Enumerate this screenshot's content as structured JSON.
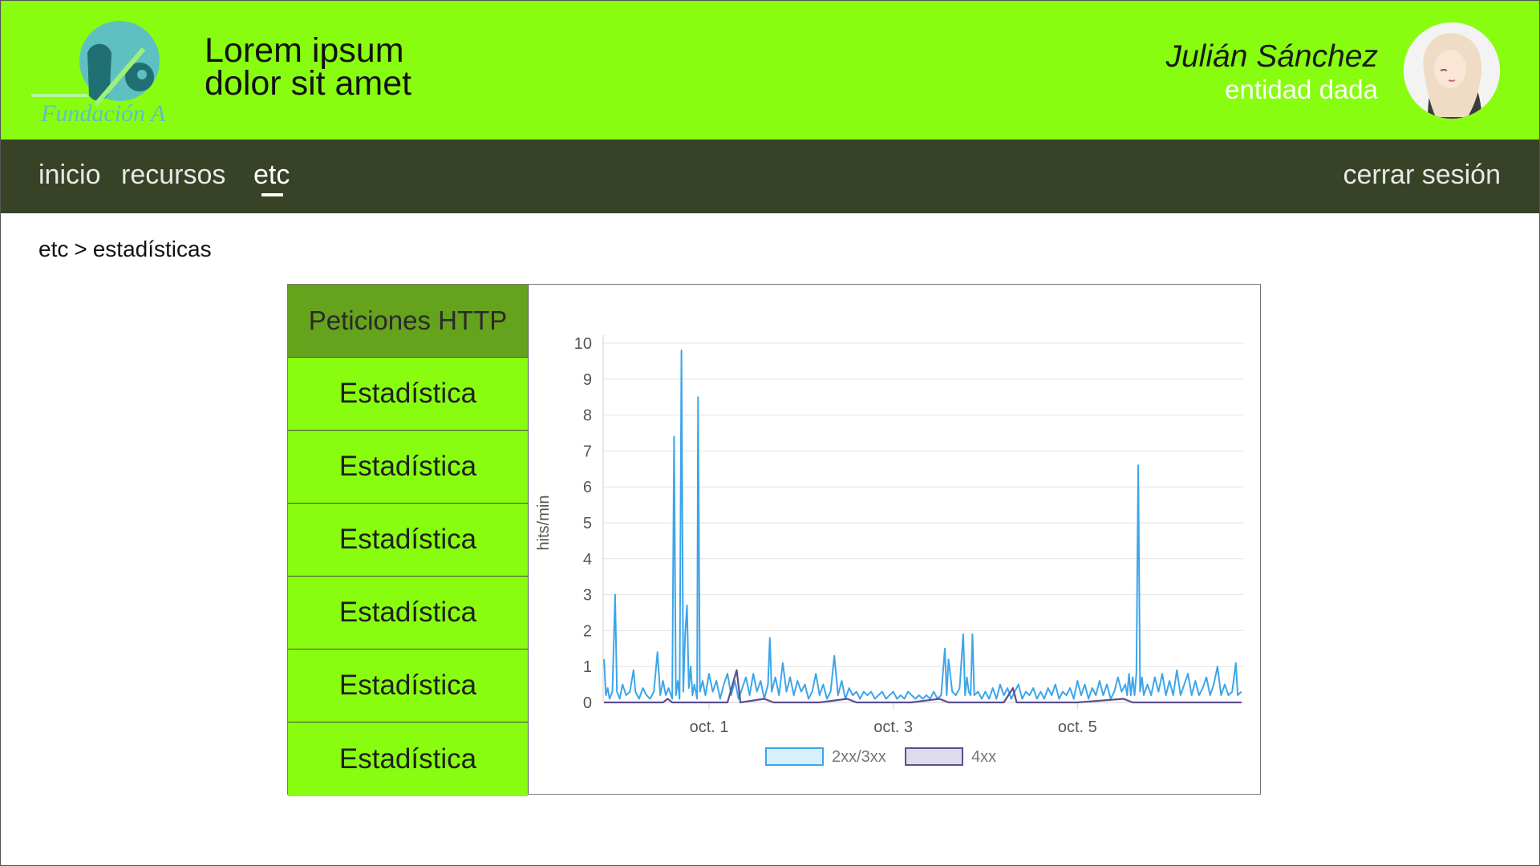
{
  "header": {
    "logo_text": "Fundación A",
    "title_line1": "Lorem ipsum",
    "title_line2": "dolor sit amet",
    "user_name": "Julián Sánchez",
    "user_entity": "entidad dada"
  },
  "nav": {
    "items": [
      {
        "label": "inicio"
      },
      {
        "label": "recursos"
      },
      {
        "label": "etc"
      }
    ],
    "active": "etc",
    "logout": "cerrar sesión"
  },
  "breadcrumb": {
    "parent": "etc",
    "separator": ">",
    "current": "estadísticas"
  },
  "stats_menu": {
    "header": "Peticiones HTTP",
    "items": [
      "Estadística",
      "Estadística",
      "Estadística",
      "Estadística",
      "Estadística",
      "Estadística"
    ]
  },
  "colors": {
    "header_bg": "#88fd10",
    "nav_bg": "#374226",
    "menu_head_bg": "#65a31c",
    "menu_item_bg": "#88fd10",
    "series_2xx": "#3da5ea",
    "series_4xx": "#5b4f8f"
  },
  "chart_data": {
    "type": "line",
    "ylabel": "hits/min",
    "ylim": [
      0,
      10
    ],
    "yticks": [
      "0",
      "1",
      "2",
      "3",
      "4",
      "5",
      "6",
      "7",
      "8",
      "9",
      "10"
    ],
    "xticks": [
      {
        "label": "oct. 1",
        "x": 1.0
      },
      {
        "label": "oct. 3",
        "x": 3.0
      },
      {
        "label": "oct. 5",
        "x": 5.0
      }
    ],
    "xlim": [
      -0.15,
      6.8
    ],
    "grid": true,
    "legend_position": "bottom",
    "series": [
      {
        "name": "2xx/3xx",
        "points": [
          [
            -0.14,
            1.2
          ],
          [
            -0.12,
            0.2
          ],
          [
            -0.1,
            0.4
          ],
          [
            -0.08,
            0.1
          ],
          [
            -0.05,
            0.3
          ],
          [
            -0.02,
            3.0
          ],
          [
            0.0,
            0.3
          ],
          [
            0.03,
            0.1
          ],
          [
            0.06,
            0.5
          ],
          [
            0.1,
            0.2
          ],
          [
            0.14,
            0.3
          ],
          [
            0.18,
            0.9
          ],
          [
            0.2,
            0.3
          ],
          [
            0.24,
            0.1
          ],
          [
            0.28,
            0.4
          ],
          [
            0.32,
            0.2
          ],
          [
            0.36,
            0.1
          ],
          [
            0.4,
            0.3
          ],
          [
            0.44,
            1.4
          ],
          [
            0.47,
            0.2
          ],
          [
            0.5,
            0.6
          ],
          [
            0.53,
            0.2
          ],
          [
            0.56,
            0.4
          ],
          [
            0.6,
            0.1
          ],
          [
            0.62,
            7.4
          ],
          [
            0.64,
            0.2
          ],
          [
            0.66,
            0.6
          ],
          [
            0.68,
            0.1
          ],
          [
            0.7,
            9.8
          ],
          [
            0.72,
            0.3
          ],
          [
            0.74,
            1.9
          ],
          [
            0.76,
            2.7
          ],
          [
            0.78,
            0.4
          ],
          [
            0.8,
            1.0
          ],
          [
            0.82,
            0.2
          ],
          [
            0.84,
            0.5
          ],
          [
            0.87,
            0.1
          ],
          [
            0.88,
            8.5
          ],
          [
            0.9,
            0.3
          ],
          [
            0.93,
            0.6
          ],
          [
            0.96,
            0.2
          ],
          [
            1.0,
            0.8
          ],
          [
            1.04,
            0.3
          ],
          [
            1.08,
            0.6
          ],
          [
            1.12,
            0.1
          ],
          [
            1.16,
            0.5
          ],
          [
            1.2,
            0.8
          ],
          [
            1.24,
            0.2
          ],
          [
            1.28,
            0.6
          ],
          [
            1.32,
            0.1
          ],
          [
            1.36,
            0.4
          ],
          [
            1.4,
            0.7
          ],
          [
            1.44,
            0.2
          ],
          [
            1.48,
            0.8
          ],
          [
            1.52,
            0.3
          ],
          [
            1.56,
            0.6
          ],
          [
            1.6,
            0.1
          ],
          [
            1.64,
            0.5
          ],
          [
            1.66,
            1.8
          ],
          [
            1.68,
            0.3
          ],
          [
            1.72,
            0.7
          ],
          [
            1.76,
            0.2
          ],
          [
            1.8,
            1.1
          ],
          [
            1.84,
            0.3
          ],
          [
            1.88,
            0.7
          ],
          [
            1.92,
            0.2
          ],
          [
            1.96,
            0.6
          ],
          [
            2.0,
            0.3
          ],
          [
            2.04,
            0.5
          ],
          [
            2.08,
            0.1
          ],
          [
            2.12,
            0.3
          ],
          [
            2.16,
            0.8
          ],
          [
            2.2,
            0.2
          ],
          [
            2.24,
            0.5
          ],
          [
            2.28,
            0.1
          ],
          [
            2.32,
            0.3
          ],
          [
            2.36,
            1.3
          ],
          [
            2.4,
            0.2
          ],
          [
            2.44,
            0.6
          ],
          [
            2.48,
            0.1
          ],
          [
            2.52,
            0.4
          ],
          [
            2.56,
            0.2
          ],
          [
            2.6,
            0.3
          ],
          [
            2.64,
            0.1
          ],
          [
            2.68,
            0.3
          ],
          [
            2.72,
            0.2
          ],
          [
            2.76,
            0.3
          ],
          [
            2.8,
            0.1
          ],
          [
            2.84,
            0.2
          ],
          [
            2.88,
            0.3
          ],
          [
            2.92,
            0.1
          ],
          [
            2.96,
            0.2
          ],
          [
            3.0,
            0.3
          ],
          [
            3.04,
            0.1
          ],
          [
            3.08,
            0.2
          ],
          [
            3.12,
            0.1
          ],
          [
            3.16,
            0.3
          ],
          [
            3.2,
            0.2
          ],
          [
            3.24,
            0.1
          ],
          [
            3.28,
            0.2
          ],
          [
            3.32,
            0.1
          ],
          [
            3.36,
            0.2
          ],
          [
            3.4,
            0.1
          ],
          [
            3.44,
            0.3
          ],
          [
            3.48,
            0.1
          ],
          [
            3.52,
            0.2
          ],
          [
            3.56,
            1.5
          ],
          [
            3.58,
            0.2
          ],
          [
            3.6,
            1.2
          ],
          [
            3.64,
            0.3
          ],
          [
            3.68,
            0.2
          ],
          [
            3.72,
            0.4
          ],
          [
            3.76,
            1.9
          ],
          [
            3.78,
            0.2
          ],
          [
            3.8,
            0.7
          ],
          [
            3.82,
            0.3
          ],
          [
            3.84,
            0.2
          ],
          [
            3.86,
            1.9
          ],
          [
            3.88,
            0.2
          ],
          [
            3.92,
            0.3
          ],
          [
            3.96,
            0.1
          ],
          [
            4.0,
            0.3
          ],
          [
            4.04,
            0.1
          ],
          [
            4.08,
            0.4
          ],
          [
            4.12,
            0.1
          ],
          [
            4.16,
            0.5
          ],
          [
            4.2,
            0.2
          ],
          [
            4.24,
            0.4
          ],
          [
            4.28,
            0.1
          ],
          [
            4.32,
            0.3
          ],
          [
            4.36,
            0.5
          ],
          [
            4.4,
            0.1
          ],
          [
            4.44,
            0.3
          ],
          [
            4.48,
            0.2
          ],
          [
            4.52,
            0.4
          ],
          [
            4.56,
            0.1
          ],
          [
            4.6,
            0.3
          ],
          [
            4.64,
            0.1
          ],
          [
            4.68,
            0.4
          ],
          [
            4.72,
            0.2
          ],
          [
            4.76,
            0.5
          ],
          [
            4.8,
            0.1
          ],
          [
            4.84,
            0.3
          ],
          [
            4.88,
            0.2
          ],
          [
            4.92,
            0.4
          ],
          [
            4.96,
            0.1
          ],
          [
            5.0,
            0.6
          ],
          [
            5.04,
            0.2
          ],
          [
            5.08,
            0.5
          ],
          [
            5.12,
            0.1
          ],
          [
            5.16,
            0.4
          ],
          [
            5.2,
            0.2
          ],
          [
            5.24,
            0.6
          ],
          [
            5.28,
            0.2
          ],
          [
            5.32,
            0.5
          ],
          [
            5.36,
            0.1
          ],
          [
            5.4,
            0.3
          ],
          [
            5.44,
            0.7
          ],
          [
            5.48,
            0.3
          ],
          [
            5.52,
            0.5
          ],
          [
            5.54,
            0.2
          ],
          [
            5.56,
            0.8
          ],
          [
            5.58,
            0.2
          ],
          [
            5.6,
            0.7
          ],
          [
            5.62,
            0.2
          ],
          [
            5.64,
            0.8
          ],
          [
            5.66,
            6.6
          ],
          [
            5.68,
            0.3
          ],
          [
            5.7,
            0.7
          ],
          [
            5.72,
            0.2
          ],
          [
            5.76,
            0.5
          ],
          [
            5.8,
            0.2
          ],
          [
            5.84,
            0.7
          ],
          [
            5.88,
            0.3
          ],
          [
            5.92,
            0.8
          ],
          [
            5.96,
            0.2
          ],
          [
            6.0,
            0.6
          ],
          [
            6.04,
            0.2
          ],
          [
            6.08,
            0.9
          ],
          [
            6.12,
            0.2
          ],
          [
            6.16,
            0.5
          ],
          [
            6.2,
            0.8
          ],
          [
            6.24,
            0.2
          ],
          [
            6.28,
            0.6
          ],
          [
            6.32,
            0.2
          ],
          [
            6.36,
            0.4
          ],
          [
            6.4,
            0.7
          ],
          [
            6.44,
            0.2
          ],
          [
            6.48,
            0.5
          ],
          [
            6.52,
            1.0
          ],
          [
            6.56,
            0.2
          ],
          [
            6.6,
            0.5
          ],
          [
            6.64,
            0.2
          ],
          [
            6.68,
            0.3
          ],
          [
            6.72,
            1.1
          ],
          [
            6.74,
            0.2
          ],
          [
            6.78,
            0.3
          ]
        ]
      },
      {
        "name": "4xx",
        "points": [
          [
            -0.14,
            0.0
          ],
          [
            0.5,
            0.0
          ],
          [
            0.55,
            0.1
          ],
          [
            0.6,
            0.0
          ],
          [
            1.0,
            0.0
          ],
          [
            1.2,
            0.0
          ],
          [
            1.3,
            0.9
          ],
          [
            1.34,
            0.0
          ],
          [
            1.6,
            0.1
          ],
          [
            1.7,
            0.0
          ],
          [
            2.2,
            0.0
          ],
          [
            2.5,
            0.1
          ],
          [
            2.6,
            0.0
          ],
          [
            3.2,
            0.0
          ],
          [
            3.5,
            0.1
          ],
          [
            3.6,
            0.0
          ],
          [
            4.2,
            0.0
          ],
          [
            4.3,
            0.4
          ],
          [
            4.34,
            0.0
          ],
          [
            5.0,
            0.0
          ],
          [
            5.5,
            0.1
          ],
          [
            5.6,
            0.0
          ],
          [
            6.2,
            0.0
          ],
          [
            6.78,
            0.0
          ]
        ]
      }
    ]
  }
}
